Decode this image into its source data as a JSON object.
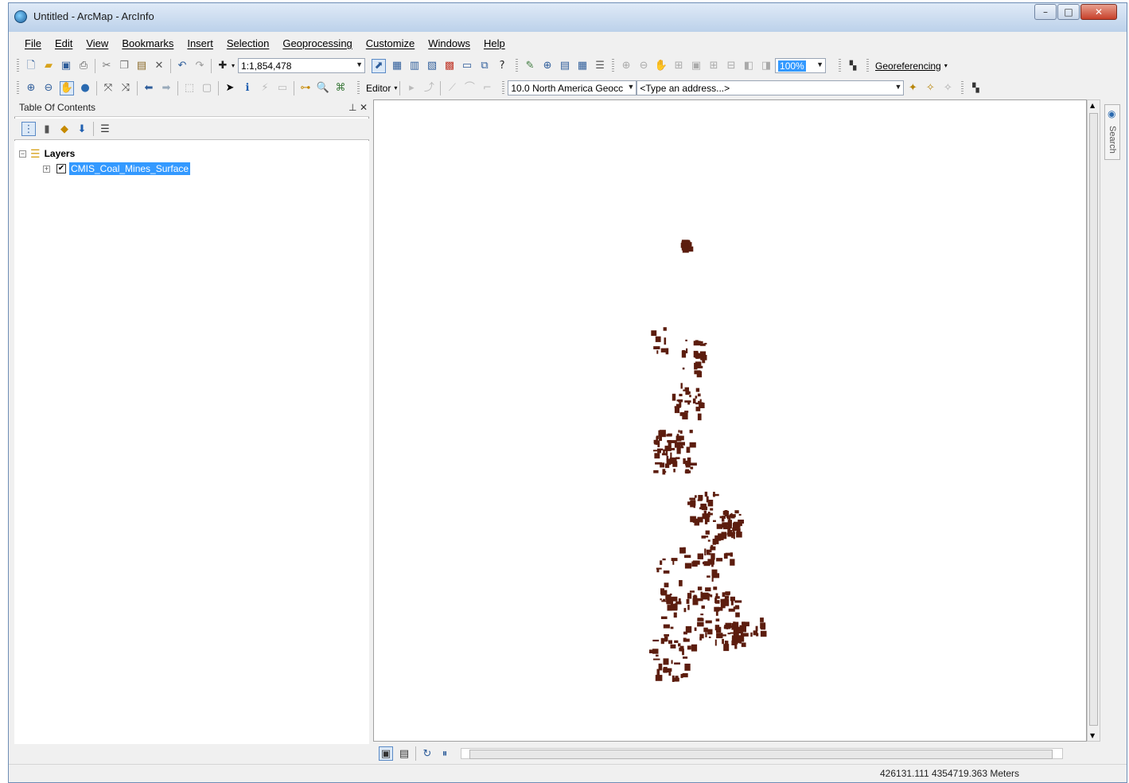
{
  "window": {
    "title": "Untitled - ArcMap - ArcInfo"
  },
  "menu": [
    "File",
    "Edit",
    "View",
    "Bookmarks",
    "Insert",
    "Selection",
    "Geoprocessing",
    "Customize",
    "Windows",
    "Help"
  ],
  "toolbar1": {
    "scale": "1:1,854,478",
    "zoom_value": "100%",
    "georeferencing_label": "Georeferencing"
  },
  "toolbar2": {
    "editor_label": "Editor",
    "geocoder": "10.0 North America Geocc",
    "address_placeholder": "<Type an address...>"
  },
  "toc": {
    "title": "Table Of Contents",
    "root_label": "Layers",
    "layers": [
      {
        "name": "CMIS_Coal_Mines_Surface",
        "checked": true,
        "selected": true
      }
    ]
  },
  "search_tab": "Search",
  "status": {
    "coordinates": "426131.111  4354719.363 Meters"
  },
  "colors": {
    "feature_fill": "#5c1d0e",
    "selection": "#3399ff"
  },
  "icons": [
    "app-globe-icon",
    "new-icon",
    "open-icon",
    "save-icon",
    "print-icon",
    "cut-icon",
    "copy-icon",
    "paste-icon",
    "delete-icon",
    "undo-icon",
    "redo-icon",
    "add-data-icon",
    "zoom-in-icon",
    "zoom-out-icon",
    "pan-icon",
    "full-extent-icon",
    "identify-icon",
    "select-icon",
    "find-icon",
    "pin-icon",
    "close-icon",
    "layer-icon",
    "search-icon"
  ]
}
